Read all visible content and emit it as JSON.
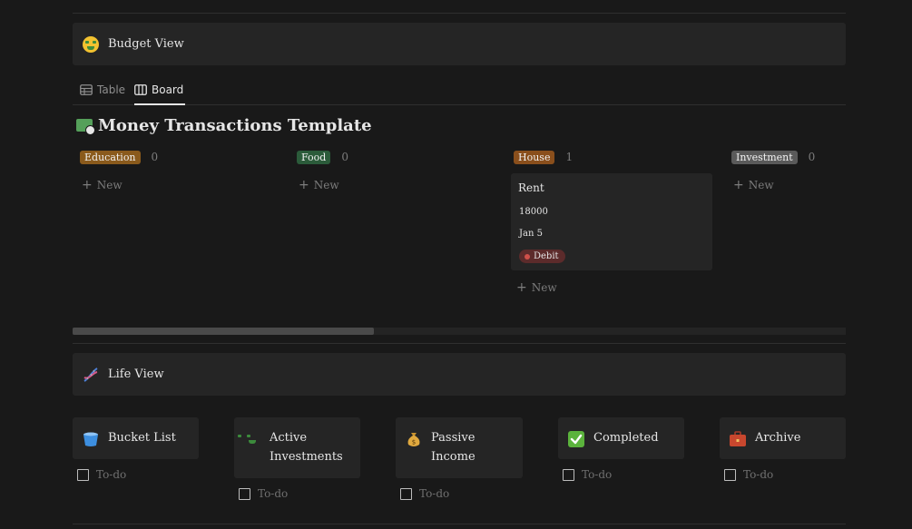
{
  "budget_view": {
    "title": "Budget View",
    "icon": "money-mouth-face-icon"
  },
  "tabs": [
    {
      "label": "Table",
      "icon": "table-icon",
      "active": false
    },
    {
      "label": "Board",
      "icon": "board-icon",
      "active": true
    }
  ],
  "database": {
    "title": "Money Transactions Template",
    "icon": "money-with-wings-icon"
  },
  "board": {
    "new_label": "New",
    "columns": [
      {
        "tag": "Education",
        "count": "0",
        "color": "#8a5a1c"
      },
      {
        "tag": "Food",
        "count": "0",
        "color": "#2b5b3a"
      },
      {
        "tag": "House",
        "count": "1",
        "color": "#8a4f1c"
      },
      {
        "tag": "Investment",
        "count": "0",
        "color": "#5a5a5a"
      }
    ],
    "card": {
      "title": "Rent",
      "amount": "18000",
      "date": "Jan 5",
      "status": "Debit",
      "status_color": "#d0504a"
    }
  },
  "scroll": {
    "position": 0.39
  },
  "life_view": {
    "title": "Life View",
    "icon": "dna-icon",
    "todo_label": "To-do",
    "cards": [
      {
        "title": "Bucket List",
        "icon": "bucket-icon"
      },
      {
        "title": "Active Investments",
        "title_line1": "Active",
        "title_line2": "Investments",
        "icon": "money-mouth-face-icon"
      },
      {
        "title": "Passive Income",
        "title_line1": "Passive",
        "title_line2": "Income",
        "icon": "money-bag-icon"
      },
      {
        "title": "Completed",
        "icon": "check-mark-icon"
      },
      {
        "title": "Archive",
        "icon": "briefcase-icon"
      }
    ]
  },
  "colors": {
    "background": "#191919",
    "panel": "#252525",
    "text": "#e6e6e6",
    "muted": "#7d7d7d"
  }
}
